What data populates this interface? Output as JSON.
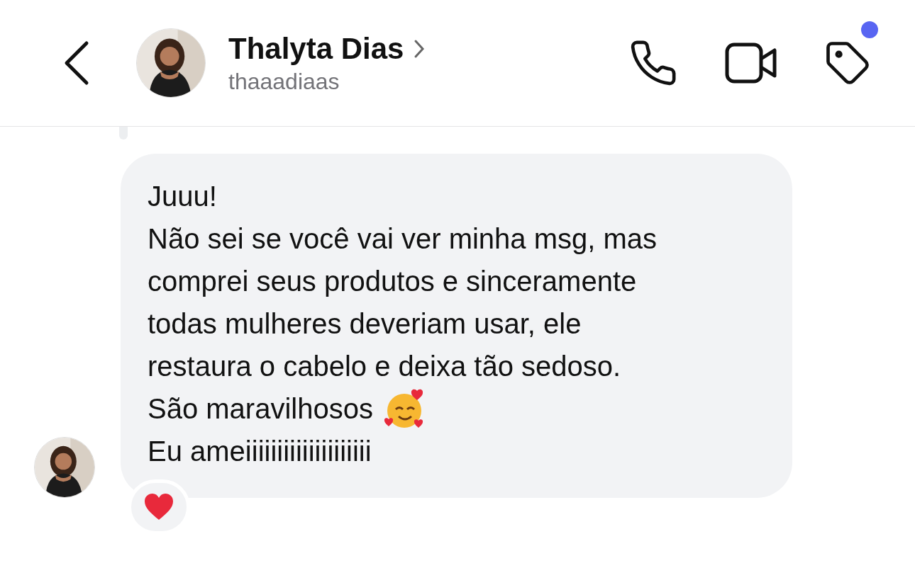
{
  "header": {
    "name": "Thalyta Dias",
    "username": "thaaadiaas",
    "tag_unread": true
  },
  "reply_bar": true,
  "message": {
    "lines": [
      {
        "text": "Juuu!"
      },
      {
        "text": "Não sei se você vai ver minha msg, mas"
      },
      {
        "text": "comprei seus produtos e sinceramente"
      },
      {
        "text": "todas mulheres deveriam usar, ele"
      },
      {
        "text": "restaura o cabelo e deixa tão sedoso."
      },
      {
        "text": "São maravilhosos",
        "has_emoji": true
      },
      {
        "text": "Eu ameiiiiiiiiiiiiiiiiiiii"
      }
    ],
    "heart_reaction": true
  }
}
